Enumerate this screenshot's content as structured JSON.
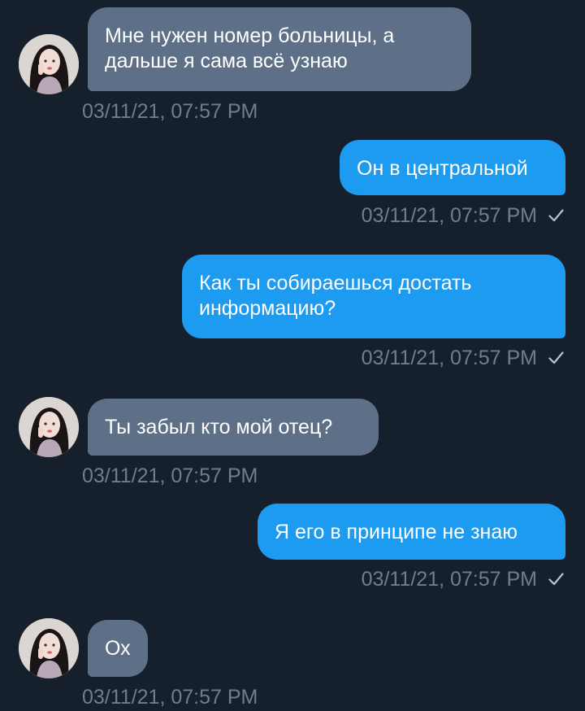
{
  "messages": [
    {
      "side": "in",
      "text": "Мне нужен номер больницы, а\nдальше я сама всё узнаю",
      "time": "03/11/21, 07:57 PM"
    },
    {
      "side": "out",
      "text": "Он в центральной",
      "time": "03/11/21, 07:57 PM"
    },
    {
      "side": "out",
      "text": "Как ты собираешься достать\nинформацию?",
      "time": "03/11/21, 07:57 PM"
    },
    {
      "side": "in",
      "text": "Ты забыл кто мой отец?",
      "time": "03/11/21, 07:57 PM"
    },
    {
      "side": "out",
      "text": "Я его в принципе не знаю",
      "time": "03/11/21, 07:57 PM"
    },
    {
      "side": "in",
      "text": "Ох",
      "time": "03/11/21, 07:57 PM"
    }
  ],
  "colors": {
    "background": "#16202c",
    "incoming_bubble": "#5e6f88",
    "outgoing_bubble": "#1d9bf0",
    "timestamp": "#6e7e92"
  },
  "icons": {
    "read_receipt": "checkmark-icon",
    "avatar": "user-avatar"
  }
}
